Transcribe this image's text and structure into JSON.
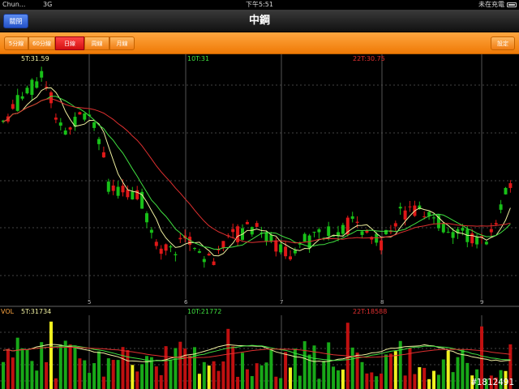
{
  "status_bar": {
    "carrier": "Chun...",
    "network": "3G",
    "time": "下午5:51",
    "charging": "未在充電"
  },
  "nav": {
    "back": "關閉",
    "title": "中鋼"
  },
  "toolbar": {
    "periods": [
      "5分線",
      "60分線",
      "日線",
      "周線",
      "月線"
    ],
    "active_period": "日線",
    "settings": "設定"
  },
  "colors": {
    "up": "#e01818",
    "down": "#18c018",
    "ma5": "#f0f0a0",
    "ma10": "#40e040",
    "ma22": "#e03030",
    "accent": "#ff8c1a"
  },
  "price_panel": {
    "ma5_label": "5T:31.59",
    "ma10_label": "10T:31",
    "ma22_label": "22T:30.75"
  },
  "volume_panel": {
    "title": "VOL",
    "ma5_label": "5T:31734",
    "ma10_label": "10T:21772",
    "ma22_label": "22T:18588"
  },
  "x_ticks": [
    "5",
    "6",
    "7",
    "8",
    "9"
  ],
  "watermark": "#1812491"
}
